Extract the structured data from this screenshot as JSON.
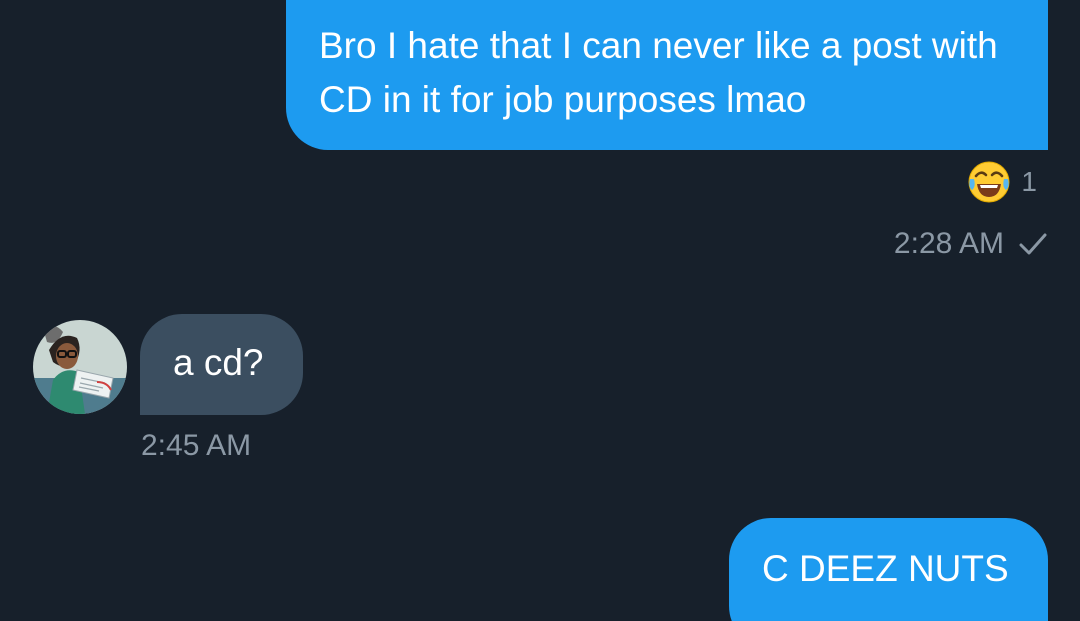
{
  "conversation": {
    "messages": [
      {
        "direction": "outgoing",
        "text": "Bro I hate that I can never like a post with CD in it for job purposes lmao",
        "reaction": {
          "emoji": "face-with-tears-of-joy-icon",
          "count": "1"
        },
        "time": "2:28 AM",
        "status": "sent-check-icon"
      },
      {
        "direction": "incoming",
        "text": "a cd?",
        "time": "2:45 AM",
        "avatar": "user-avatar"
      },
      {
        "direction": "outgoing",
        "text": "C DEEZ NUTS"
      }
    ]
  },
  "colors": {
    "background": "#17202b",
    "outgoing_bubble": "#1d9bf0",
    "incoming_bubble": "#3b4e60",
    "meta_text": "#8b98a5"
  }
}
